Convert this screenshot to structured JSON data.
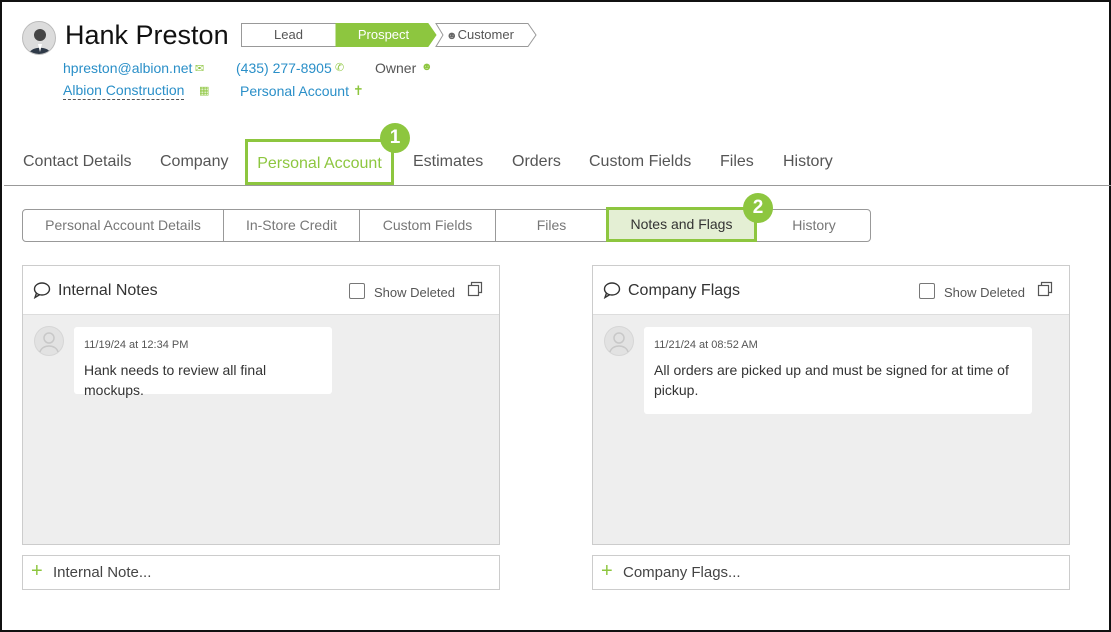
{
  "contact": {
    "name": "Hank Preston",
    "email": "hpreston@albion.net",
    "phone": "(435) 277-8905",
    "owner_label": "Owner",
    "company": "Albion Construction",
    "account": "Personal Account"
  },
  "pipeline": {
    "stages": [
      "Lead",
      "Prospect",
      "Customer"
    ],
    "active_stage": "Prospect"
  },
  "tabs": [
    "Contact Details",
    "Company",
    "Personal Account",
    "Estimates",
    "Orders",
    "Custom Fields",
    "Files",
    "History"
  ],
  "active_tab": "Personal Account",
  "subtabs": [
    "Personal Account Details",
    "In-Store Credit",
    "Custom Fields",
    "Files",
    "Notes and Flags",
    "History"
  ],
  "active_subtab": "Notes and Flags",
  "callouts": [
    "1",
    "2"
  ],
  "panels": {
    "internal_notes": {
      "title": "Internal Notes",
      "show_deleted": "Show Deleted",
      "note": {
        "date": "11/19/24 at 12:34 PM",
        "text": "Hank needs to review all final mockups."
      },
      "add_label": "Internal Note..."
    },
    "company_flags": {
      "title": "Company Flags",
      "show_deleted": "Show Deleted",
      "note": {
        "date": "11/21/24 at 08:52 AM",
        "text": "All orders are picked up and must be signed for at time of pickup."
      },
      "add_label": "Company Flags..."
    }
  },
  "colors": {
    "accent": "#8dc63f",
    "link": "#2a8fc8",
    "active_subtab_bg": "#e4efd4"
  }
}
